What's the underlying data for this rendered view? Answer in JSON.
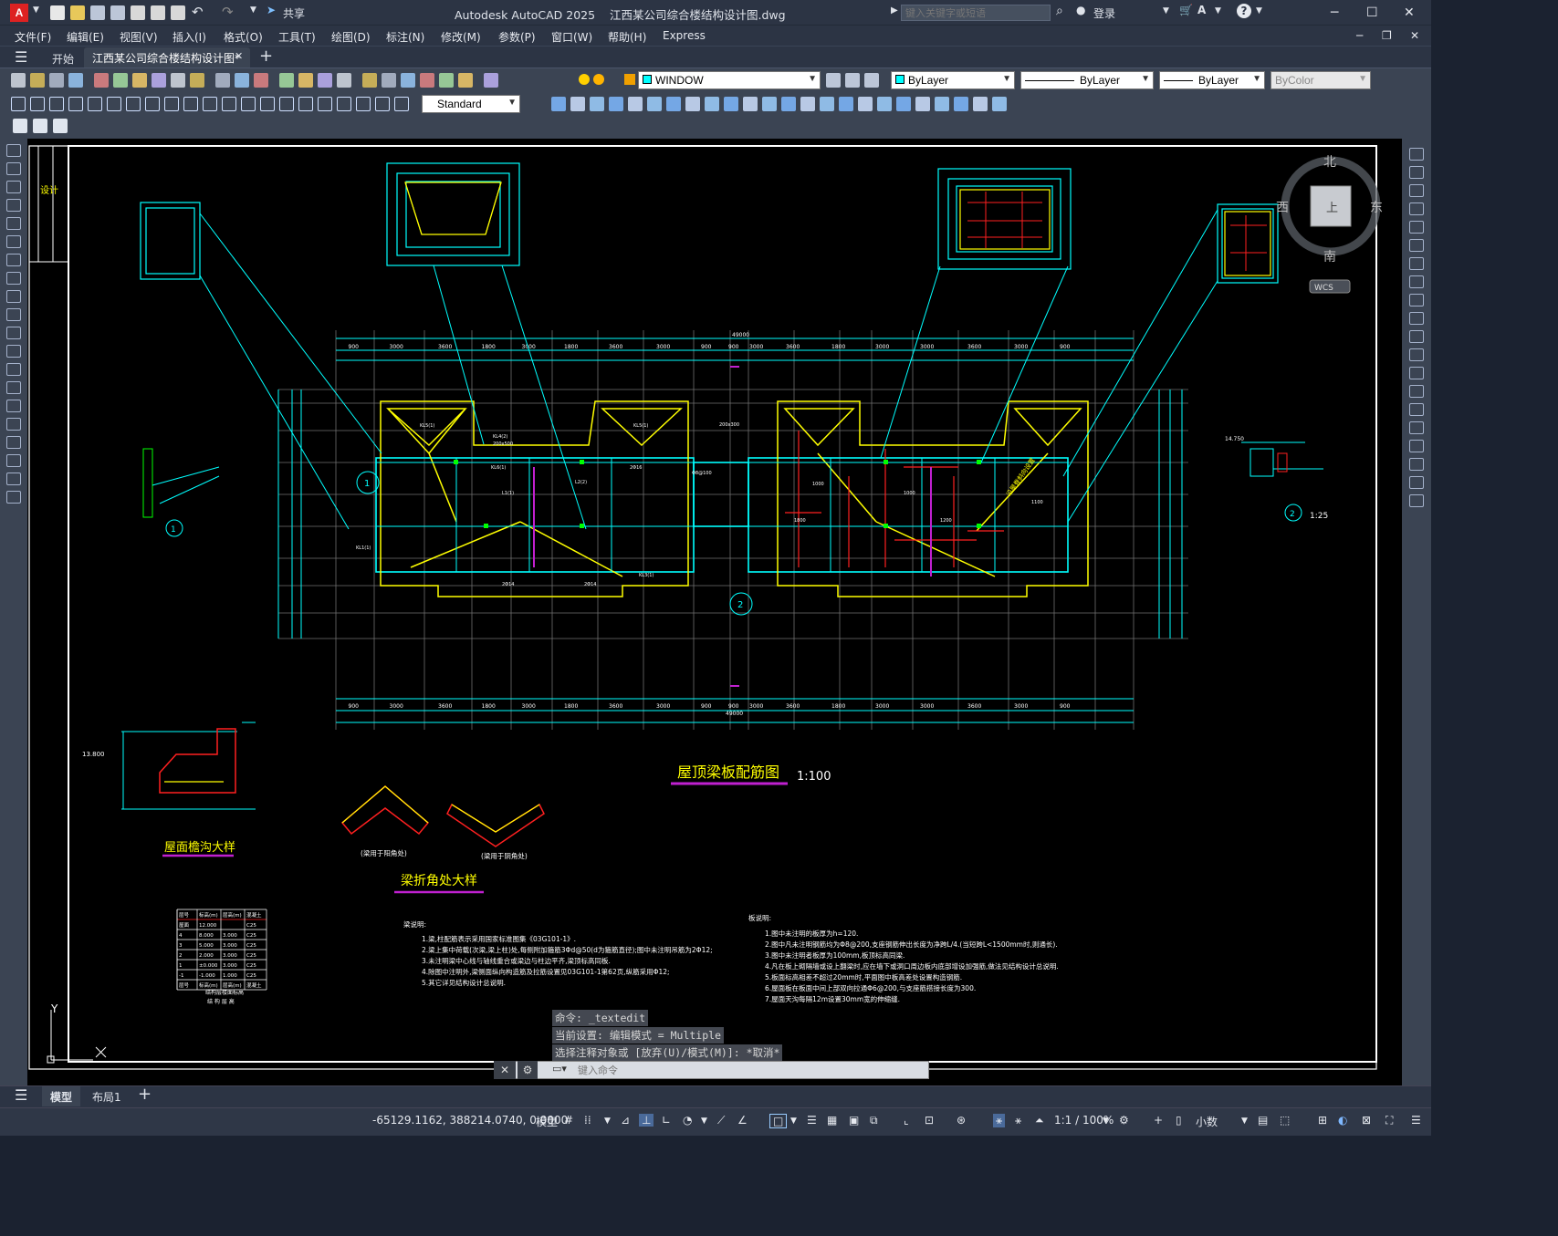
{
  "title": {
    "app": "Autodesk AutoCAD 2025",
    "file": "江西某公司综合楼结构设计图.dwg",
    "search_placeholder": "键入关键字或短语",
    "login": "登录",
    "share": "共享"
  },
  "menu": [
    "文件(F)",
    "编辑(E)",
    "视图(V)",
    "插入(I)",
    "格式(O)",
    "工具(T)",
    "绘图(D)",
    "标注(N)",
    "修改(M)",
    "参数(P)",
    "窗口(W)",
    "帮助(H)",
    "Express"
  ],
  "tabs": {
    "start": "开始",
    "doc": "江西某公司综合楼结构设计图*"
  },
  "ribbon": {
    "layer": "WINDOW",
    "color": "ByLayer",
    "linetype": "ByLayer",
    "lineweight": "ByLayer",
    "plotstyle": "ByColor",
    "textstyle": "Standard"
  },
  "viewcube": {
    "north": "北",
    "south": "南",
    "west": "西",
    "east": "东",
    "face": "上",
    "wcs": "WCS"
  },
  "drawing": {
    "main_title": "屋顶梁板配筋图",
    "main_scale": "1:100",
    "gutter_title": "屋面檐沟大样",
    "corner_title": "梁折角处大样",
    "corner_a_caption": "(梁用于阳角处)",
    "corner_b_caption": "(梁用于阴角处)",
    "detail2_scale": "1:25",
    "elev_label": "13.800",
    "elev_label2": "14.750",
    "top_dims": [
      "900",
      "3000",
      "3600",
      "1800",
      "3000",
      "1800",
      "3600",
      "3000",
      "900",
      "900",
      "3000",
      "3600",
      "1800",
      "3000",
      "3000",
      "3600",
      "3000",
      "900"
    ],
    "total_dim": "49000",
    "notes_beam_title": "梁说明:",
    "notes_beam": [
      "1.梁,柱配筋表示采用国家标准图集《03G101-1》.",
      "2.梁上集中荷载(次梁,梁上柱)处,每侧附加箍筋3Φd@50(d为箍筋直径);图中未注明吊筋为2Φ12;",
      "3.未注明梁中心线与轴线重合或梁边与柱边平齐,梁顶标高同板.",
      "4.除图中注明外,梁侧面纵向构造筋及拉筋设置见03G101-1第62页,纵筋采用Φ12;",
      "5.其它详见结构设计总说明."
    ],
    "notes_slab_title": "板说明:",
    "notes_slab": [
      "1.图中未注明的板厚为h=120.",
      "2.图中凡未注明钢筋均为Φ8@200,支座钢筋伸出长度为净跨L/4.(当短跨L<1500mm时,则通长).",
      "3.图中未注明者板厚为100mm,板顶标高同梁.",
      "4.凡在板上砌隔墙或设上翻梁时,应在墙下或洞口周边板内底部增设加强筋,做法见结构设计总说明.",
      "5.板面标高相差不超过20mm时,平面图中板高差处设置构造钢筋.",
      "6.屋面板在板面中间上部双向拉通Φ6@200,与支座筋搭接长度为300.",
      "7.屋面天沟每隔12m设置30mm宽的伸缩缝."
    ],
    "table_header": [
      "层号",
      "标高(m)",
      "层高(m)",
      "混凝土"
    ],
    "table_rows": [
      [
        "屋面",
        "12.000",
        "",
        "C25"
      ],
      [
        "4",
        "8.000",
        "3.000",
        "C25"
      ],
      [
        "3",
        "5.000",
        "3.000",
        "C25"
      ],
      [
        "2",
        "2.000",
        "3.000",
        "C25"
      ],
      [
        "1",
        "±0.000",
        "3.000",
        "C25"
      ],
      [
        "-1",
        "-1.000",
        "1.000",
        "C25"
      ],
      [
        "层号",
        "标高(m)",
        "层高(m)",
        "混凝土"
      ]
    ],
    "table_caption1": "结构层楼面标高",
    "table_caption2": "结 构 层 高",
    "axis_y": "Y",
    "circle1": "1",
    "circle2": "2"
  },
  "command": {
    "history": [
      "命令: _textedit",
      "当前设置: 编辑模式 = Multiple",
      "选择注释对象或 [放弃(U)/模式(M)]: *取消*"
    ],
    "placeholder": "键入命令"
  },
  "layouts": {
    "model": "模型",
    "layout1": "布局1"
  },
  "status": {
    "coords": "-65129.1162, 388214.0740, 0.0000",
    "mode": "模型",
    "scale": "1:1 / 100%",
    "units": "小数"
  },
  "colors": {
    "cyan": "#00ffff",
    "yellow": "#ffff00",
    "red": "#ff0000",
    "green": "#00ff00",
    "magenta": "#c020d0",
    "white": "#ffffff",
    "gray": "#808080"
  }
}
